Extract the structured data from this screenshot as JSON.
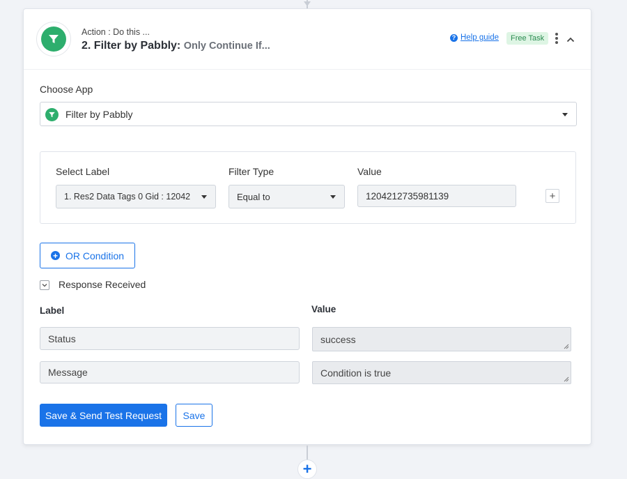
{
  "header": {
    "action_sub": "Action : Do this ...",
    "title_main": "2. Filter by Pabbly:",
    "title_sub": "Only Continue If...",
    "help_label": "Help guide",
    "badge": "Free Task",
    "app_icon": "filter-icon"
  },
  "choose_app": {
    "label": "Choose App",
    "selected": "Filter by Pabbly"
  },
  "filter": {
    "col_label": "Select Label",
    "col_type": "Filter Type",
    "col_value": "Value",
    "label_selected": "1. Res2 Data Tags 0 Gid : 12042",
    "type_selected": "Equal to",
    "value": "1204212735981139",
    "add_icon": "+"
  },
  "or_condition": {
    "label": "OR Condition",
    "icon": "+"
  },
  "response": {
    "title": "Response Received",
    "col_label": "Label",
    "col_value": "Value",
    "rows": [
      {
        "label": "Status",
        "value": "success"
      },
      {
        "label": "Message",
        "value": "Condition is true"
      }
    ]
  },
  "buttons": {
    "save_test": "Save & Send Test Request",
    "save": "Save"
  },
  "bottom": {
    "add_icon": "+"
  },
  "colors": {
    "primary": "#1a73e8",
    "brand_green": "#2dae6d",
    "badge_bg": "#def5e4",
    "badge_text": "#2a8b50"
  }
}
